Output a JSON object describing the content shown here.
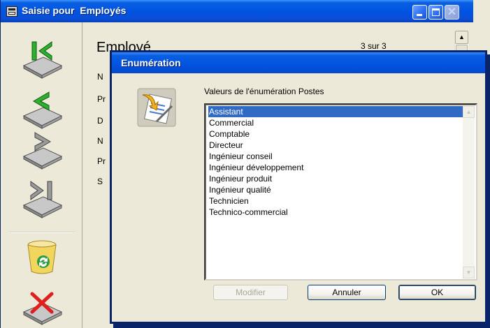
{
  "main_window": {
    "title": "Saisie pour  Employés",
    "form_title": "Employé",
    "record_counter": "3 sur 3",
    "field_labels": [
      "N",
      "Pr",
      "D",
      "N",
      "Pr",
      "S"
    ],
    "toolbar": {
      "first_icon": "first-record-icon",
      "previous_icon": "previous-record-icon",
      "next_icon": "next-record-icon",
      "last_icon": "last-record-icon",
      "recycle_icon": "recycle-bin-icon",
      "delete_icon": "delete-record-icon"
    }
  },
  "dialog": {
    "title": "Enumération",
    "list_caption": "Valeurs de l'énumération Postes",
    "items": [
      "Assistant",
      "Commercial",
      "Comptable",
      "Directeur",
      "Ingénieur conseil",
      "Ingénieur développement",
      "Ingénieur produit",
      "Ingénieur qualité",
      "Technicien",
      "Technico-commercial"
    ],
    "selected_index": 0,
    "buttons": {
      "modifier": "Modifier",
      "annuler": "Annuler",
      "ok": "OK"
    }
  },
  "colors": {
    "titlebar_blue": "#0054e3",
    "selection": "#316ac5",
    "window_bg": "#ece9d8"
  }
}
